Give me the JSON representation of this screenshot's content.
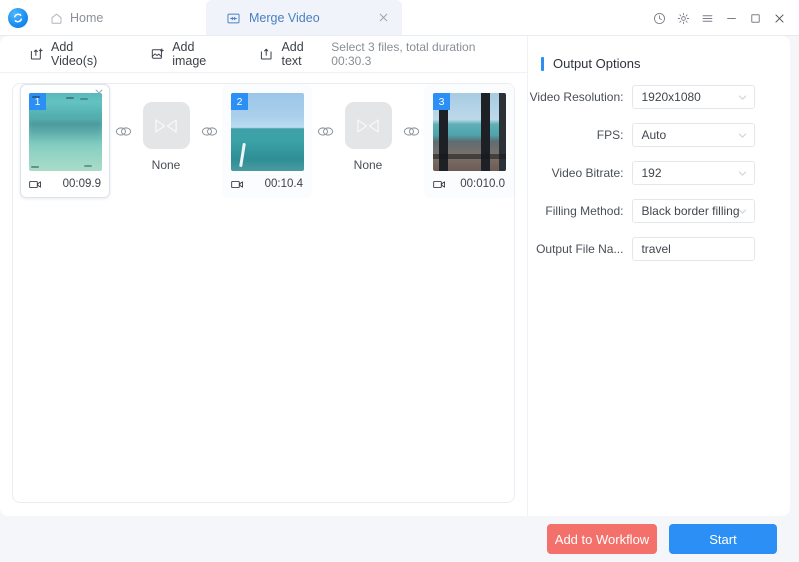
{
  "titlebar": {
    "logo_icon": "app-logo-icon",
    "home_label": "Home",
    "home_icon": "home-icon",
    "tab": {
      "icon": "merge-video-icon",
      "label": "Merge Video",
      "close_icon": "close-icon"
    },
    "controls": [
      {
        "name": "history-icon",
        "glyph": "clock"
      },
      {
        "name": "settings-gear-icon",
        "glyph": "gear"
      },
      {
        "name": "menu-icon",
        "glyph": "hamburger"
      },
      {
        "name": "minimize-icon",
        "glyph": "minimize"
      },
      {
        "name": "maximize-icon",
        "glyph": "maximize"
      },
      {
        "name": "close-window-icon",
        "glyph": "close"
      }
    ]
  },
  "toolbar": {
    "add_videos_label": "Add Video(s)",
    "add_image_label": "Add image",
    "add_text_label": "Add text",
    "status": "Select 3 files, total duration 00:30.3"
  },
  "clips": [
    {
      "index": "1",
      "duration": "00:09.9",
      "selected": true,
      "thumb": "ocean-aerial-thumbnail"
    },
    {
      "index": "2",
      "duration": "00:10.4",
      "selected": false,
      "thumb": "sea-horizon-thumbnail"
    },
    {
      "index": "3",
      "duration": "00:010.0",
      "selected": false,
      "thumb": "window-balcony-thumbnail"
    }
  ],
  "transitions": [
    {
      "label": "None",
      "icon": "transition-bowtie-icon"
    },
    {
      "label": "None",
      "icon": "transition-bowtie-icon"
    }
  ],
  "output_options": {
    "title": "Output Options",
    "fields": [
      {
        "label": "Video Resolution:",
        "value": "1920x1080",
        "type": "select"
      },
      {
        "label": "FPS:",
        "value": "Auto",
        "type": "select"
      },
      {
        "label": "Video Bitrate:",
        "value": "192",
        "type": "select"
      },
      {
        "label": "Filling Method:",
        "value": "Black border filling",
        "type": "select"
      },
      {
        "label": "Output File Na...",
        "value": "travel",
        "type": "text"
      }
    ]
  },
  "footer": {
    "add_to_workflow_label": "Add to Workflow",
    "start_label": "Start",
    "workflow_color": "#f4706b",
    "start_color": "#2b8ff5"
  }
}
